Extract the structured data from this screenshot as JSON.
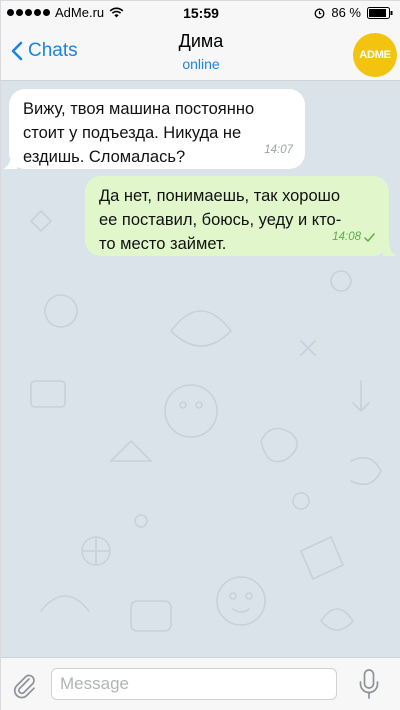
{
  "status_bar": {
    "carrier": "AdMe.ru",
    "time": "15:59",
    "battery": "86 %"
  },
  "nav": {
    "back_label": "Chats",
    "title": "Дима",
    "subtitle": "online",
    "avatar_text": "ADME"
  },
  "messages": [
    {
      "direction": "incoming",
      "lines": [
        "Вижу, твоя машина постоянно",
        "стоит у подъезда. Никуда не",
        "ездишь. Сломалась?"
      ],
      "time": "14:07"
    },
    {
      "direction": "outgoing",
      "lines": [
        "Да нет, понимаешь, так хорошо",
        "ее поставил, боюсь, уеду и кто-",
        "то место займет."
      ],
      "time": "14:08",
      "status_icon": "check-icon"
    }
  ],
  "composer": {
    "placeholder": "Message",
    "value": ""
  },
  "colors": {
    "accent": "#1a85e2",
    "chat_background": "#dbe3ea",
    "incoming_bubble": "#ffffff",
    "outgoing_bubble": "#e1f7cb",
    "outgoing_time": "#5cae49",
    "avatar": "#f2c40f"
  },
  "icons": [
    "wifi-icon",
    "alarm-icon",
    "battery-icon",
    "chevron-left-icon",
    "check-icon",
    "paperclip-icon",
    "microphone-icon"
  ]
}
